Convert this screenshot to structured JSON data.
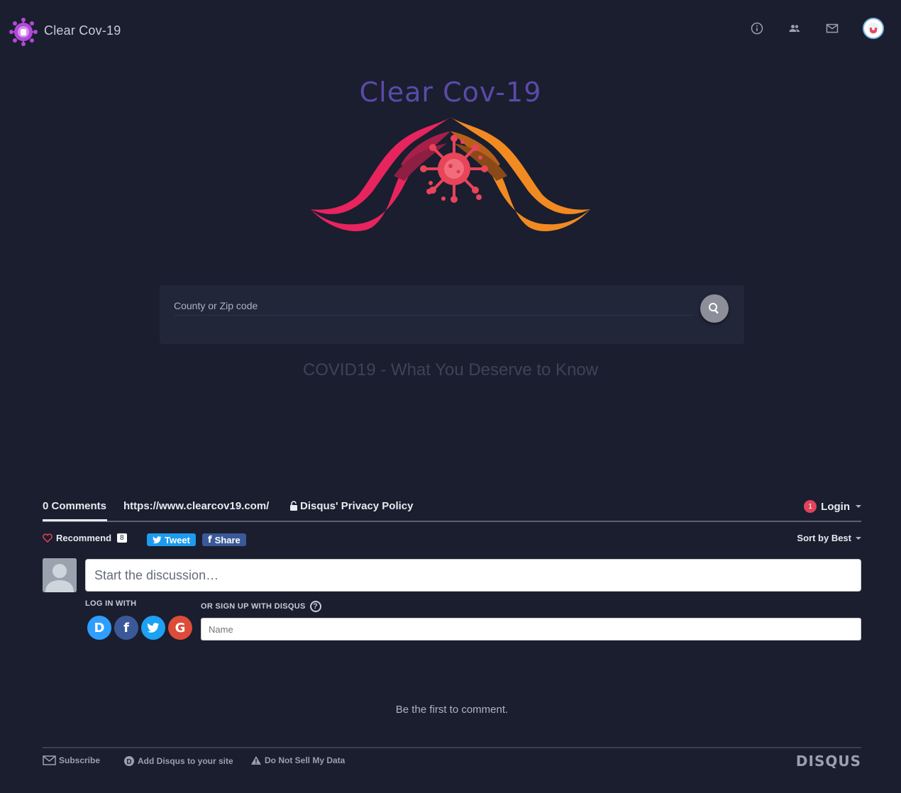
{
  "header": {
    "brand_name": "Clear Cov-19",
    "nav_icons": [
      "info-icon",
      "people-icon",
      "mail-icon"
    ],
    "avatar": "user-avatar"
  },
  "hero": {
    "title": "Clear Cov-19",
    "tagline": "COVID19 - What You Deserve to Know"
  },
  "search": {
    "placeholder": "County or Zip code"
  },
  "disqus": {
    "nav": {
      "comments_tab": "0 Comments",
      "site_url": "https://www.clearcov19.com/",
      "privacy": "Disqus' Privacy Policy",
      "login_badge": "1",
      "login": "Login"
    },
    "actions": {
      "recommend": "Recommend",
      "recommend_count": "8",
      "tweet": "Tweet",
      "share": "Share",
      "sort": "Sort by Best"
    },
    "composer": {
      "placeholder": "Start the discussion…",
      "login_with": "LOG IN WITH",
      "signup_label": "OR SIGN UP WITH DISQUS",
      "name_placeholder": "Name",
      "help": "?"
    },
    "empty_message": "Be the first to comment.",
    "footer": {
      "subscribe": "Subscribe",
      "add_disqus": "Add Disqus to your site",
      "do_not_sell": "Do Not Sell My Data",
      "logo": "DISQUS"
    }
  },
  "colors": {
    "background": "#1a1e2f",
    "title_purple": "#5b4aa8",
    "hand_pink": "#e8245e",
    "hand_orange": "#f28a22",
    "virus": "#e8445a"
  }
}
